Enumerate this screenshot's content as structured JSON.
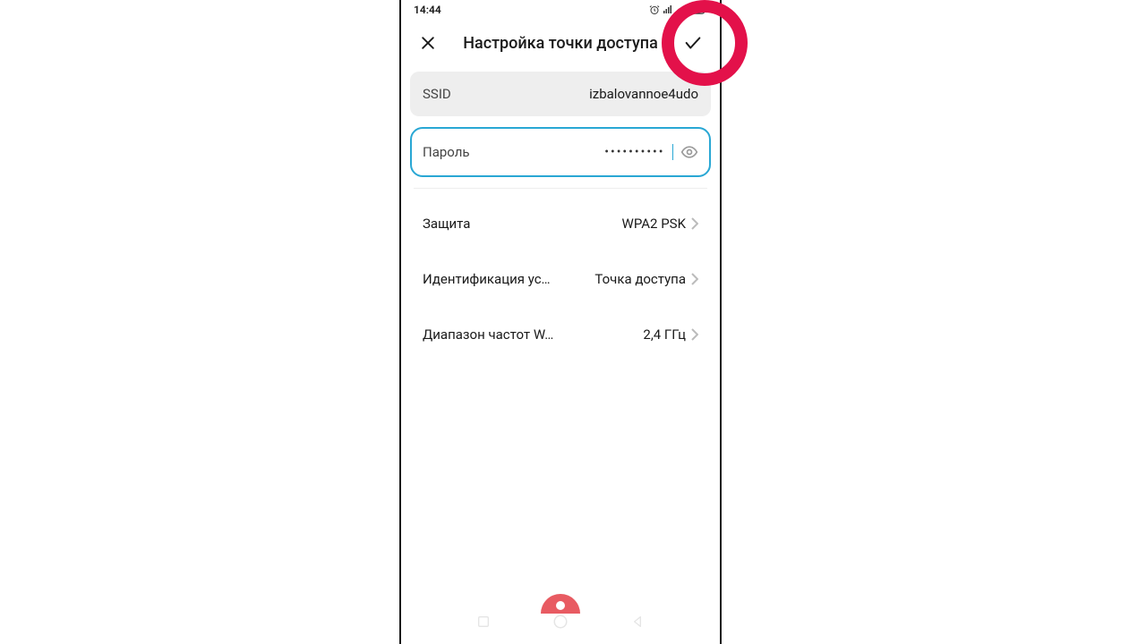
{
  "status": {
    "time": "14:44",
    "icons": "⏰ 📶 📡 🔋"
  },
  "header": {
    "title": "Настройка точки доступа"
  },
  "fields": {
    "ssid_label": "SSID",
    "ssid_value": "izbalovannoe4udo",
    "password_label": "Пароль",
    "password_dots": "••••••••••"
  },
  "rows": {
    "security_label": "Защита",
    "security_value": "WPA2 PSK",
    "device_id_label": "Идентификация ус…",
    "device_id_value": "Точка доступа",
    "band_label": "Диапазон частот W…",
    "band_value": "2,4 ГГц"
  }
}
